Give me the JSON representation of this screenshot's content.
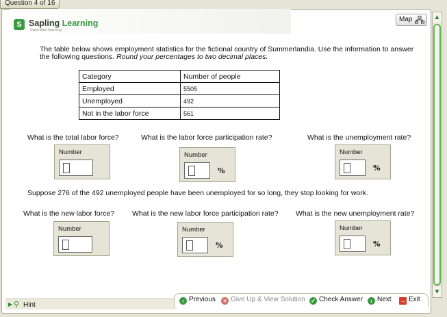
{
  "tab": {
    "label": "Question 4 of 16"
  },
  "brand": {
    "name_first": "Sapling",
    "name_second": "Learning",
    "sub": "macmillan learning"
  },
  "map_button": {
    "label": "Map"
  },
  "intro": {
    "text": "The table below shows employment statistics for the fictional country of Summerlandia. Use the information to answer the following questions. ",
    "italic": "Round your percentages to two decimal places."
  },
  "table": {
    "headers": [
      "Category",
      "Number of people"
    ],
    "rows": [
      [
        "Employed",
        "5505"
      ],
      [
        "Unemployed",
        "492"
      ],
      [
        "Not in the labor force",
        "561"
      ]
    ]
  },
  "questions_part1": [
    {
      "text": "What is the total labor force?",
      "box_label": "Number",
      "value": ""
    },
    {
      "text": "What is the labor force participation rate?",
      "box_label": "Number",
      "value": "",
      "unit": "%"
    },
    {
      "text": "What is the unemployment rate?",
      "box_label": "Number",
      "value": "",
      "unit": "%"
    }
  ],
  "scenario": "Suppose 276 of the 492 unemployed people have been unemployed for so long, they stop looking for work.",
  "questions_part2": [
    {
      "text": "What is the new labor force?",
      "box_label": "Number",
      "value": ""
    },
    {
      "text": "What is the new labor force participation rate?",
      "box_label": "Number",
      "value": "",
      "unit": "%"
    },
    {
      "text": "What is the new unemployment rate?",
      "box_label": "Number",
      "value": "",
      "unit": "%"
    }
  ],
  "footer": {
    "hint": "Hint",
    "previous": "Previous",
    "give_up": "Give Up & View Solution",
    "check": "Check Answer",
    "next": "Next",
    "exit": "Exit"
  },
  "colors": {
    "accent_green": "#3a9a3f",
    "panel": "#e6e4d6"
  }
}
